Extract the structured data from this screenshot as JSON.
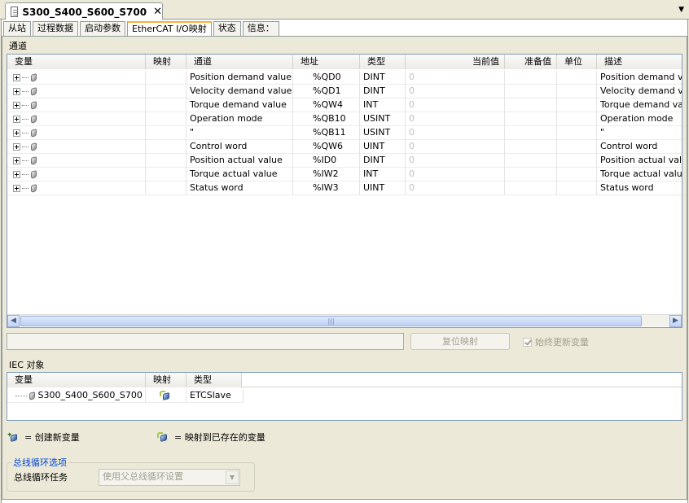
{
  "doc_tab": {
    "title": "S300_S400_S600_S700",
    "close": "✕"
  },
  "editor_tabs": [
    "从站",
    "过程数据",
    "启动参数",
    "EtherCAT I/O映射",
    "状态",
    "信息："
  ],
  "channels_label": "通道",
  "channel_columns": [
    "变量",
    "映射",
    "通道",
    "地址",
    "类型",
    "当前值",
    "准备值",
    "单位",
    "描述"
  ],
  "channels": [
    {
      "channel": "Position demand value",
      "address": "%QD0",
      "type": "DINT",
      "current": "0",
      "desc": "Position demand value"
    },
    {
      "channel": "Velocity demand value",
      "address": "%QD1",
      "type": "DINT",
      "current": "0",
      "desc": "Velocity demand value"
    },
    {
      "channel": "Torque demand value",
      "address": "%QW4",
      "type": "INT",
      "current": "0",
      "desc": "Torque demand value"
    },
    {
      "channel": "Operation mode",
      "address": "%QB10",
      "type": "USINT",
      "current": "0",
      "desc": "Operation mode"
    },
    {
      "channel": "\"",
      "address": "%QB11",
      "type": "USINT",
      "current": "0",
      "desc": "\""
    },
    {
      "channel": "Control word",
      "address": "%QW6",
      "type": "UINT",
      "current": "0",
      "desc": "Control word"
    },
    {
      "channel": "Position actual value",
      "address": "%ID0",
      "type": "DINT",
      "current": "0",
      "desc": "Position actual value"
    },
    {
      "channel": "Torque actual value",
      "address": "%IW2",
      "type": "INT",
      "current": "0",
      "desc": "Torque actual value"
    },
    {
      "channel": "Status word",
      "address": "%IW3",
      "type": "UINT",
      "current": "0",
      "desc": "Status word"
    }
  ],
  "reset_mapping_label": "复位映射",
  "always_update_label": "始终更新变量",
  "iec_label": "IEC 对象",
  "iec_columns": [
    "变量",
    "映射",
    "类型"
  ],
  "iec_rows": [
    {
      "variable": "S300_S400_S600_S700",
      "type": "ETCSlave"
    }
  ],
  "legend": {
    "create_new": "= 创建新变量",
    "map_existing": "= 映射到已存在的变量"
  },
  "bus_cycle": {
    "title": "总线循环选项",
    "task_label": "总线循环任务",
    "task_value": "使用父总线循环设置"
  },
  "colors": {
    "active_tab_accent": "#f7b13c",
    "group_title": "#0046d5"
  }
}
